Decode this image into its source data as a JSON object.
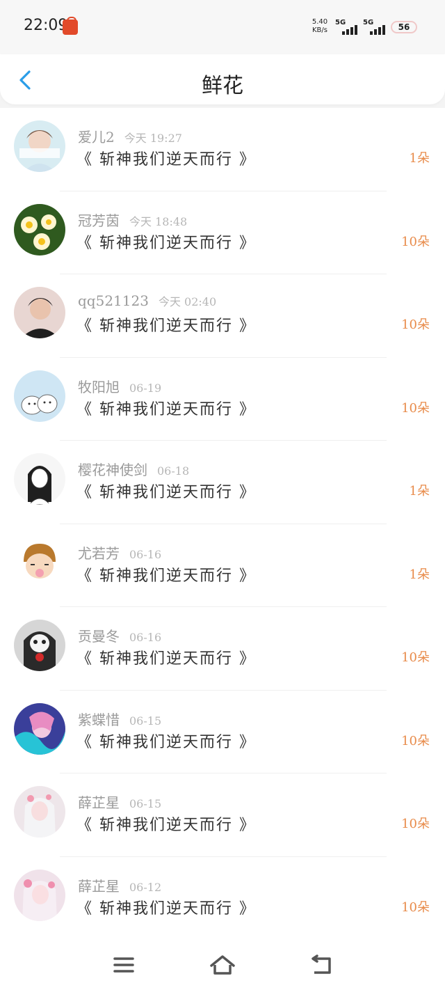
{
  "status_bar": {
    "time": "22:09",
    "net_speed_value": "5.40",
    "net_speed_unit": "KB/s",
    "signal_1_label": "5G",
    "signal_2_label": "5G",
    "battery": "56"
  },
  "header": {
    "title": "鲜花",
    "back_icon": "chevron-left-icon",
    "accent_color": "#2a9de8"
  },
  "list": {
    "count_color": "#e88b4a",
    "items": [
      {
        "name": "爱儿2",
        "date": "今天 19:27",
        "work": "《 斩神我们逆天而行 》",
        "count": "1朵"
      },
      {
        "name": "冠芳茵",
        "date": "今天 18:48",
        "work": "《 斩神我们逆天而行 》",
        "count": "10朵"
      },
      {
        "name": "qq521123",
        "date": "今天 02:40",
        "work": "《 斩神我们逆天而行 》",
        "count": "10朵"
      },
      {
        "name": "牧阳旭",
        "date": "06-19",
        "work": "《 斩神我们逆天而行 》",
        "count": "10朵"
      },
      {
        "name": "樱花神使剑",
        "date": "06-18",
        "work": "《 斩神我们逆天而行 》",
        "count": "1朵"
      },
      {
        "name": "尤若芳",
        "date": "06-16",
        "work": "《 斩神我们逆天而行 》",
        "count": "1朵"
      },
      {
        "name": "贡曼冬",
        "date": "06-16",
        "work": "《 斩神我们逆天而行 》",
        "count": "10朵"
      },
      {
        "name": "紫蝶惜",
        "date": "06-15",
        "work": "《 斩神我们逆天而行 》",
        "count": "10朵"
      },
      {
        "name": "薛芷星",
        "date": "06-15",
        "work": "《 斩神我们逆天而行 》",
        "count": "10朵"
      },
      {
        "name": "薛芷星",
        "date": "06-12",
        "work": "《 斩神我们逆天而行 》",
        "count": "10朵"
      }
    ]
  },
  "nav_bar": {
    "menu_icon": "menu-icon",
    "home_icon": "home-icon",
    "back_icon": "back-arrow-icon"
  }
}
